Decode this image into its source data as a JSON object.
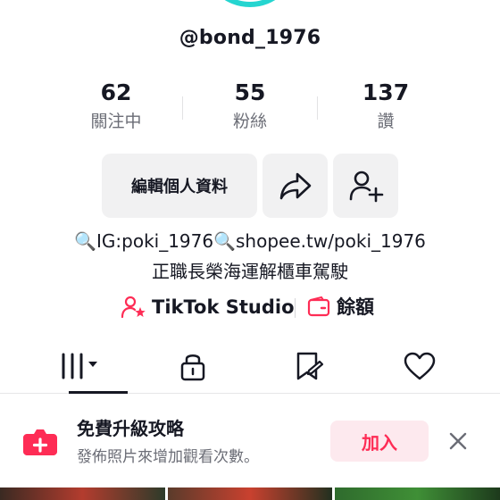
{
  "profile": {
    "username": "@bond_1976",
    "stats": [
      {
        "value": "62",
        "label": "關注中"
      },
      {
        "value": "55",
        "label": "粉絲"
      },
      {
        "value": "137",
        "label": "讚"
      }
    ],
    "edit_button": "編輯個人資料",
    "bio_line1": "🔍IG:poki_1976🔍shopee.tw/poki_1976",
    "bio_line2": "正職長榮海運解櫃車駕駛",
    "studio_label": "TikTok Studio",
    "wallet_label": "餘額"
  },
  "tabs": [
    {
      "icon": "grid-icon",
      "active": true
    },
    {
      "icon": "lock-icon",
      "active": false
    },
    {
      "icon": "bookmark-icon",
      "active": false
    },
    {
      "icon": "heart-icon",
      "active": false
    }
  ],
  "promo": {
    "title": "免費升級攻略",
    "subtitle": "發佈照片來增加觀看次數。",
    "join_label": "加入"
  },
  "colors": {
    "accent": "#fe2c55",
    "avatar_ring": "#25d5d0",
    "text_primary": "#161823",
    "text_secondary": "#6b6d76",
    "button_bg": "#f1f1f2"
  }
}
